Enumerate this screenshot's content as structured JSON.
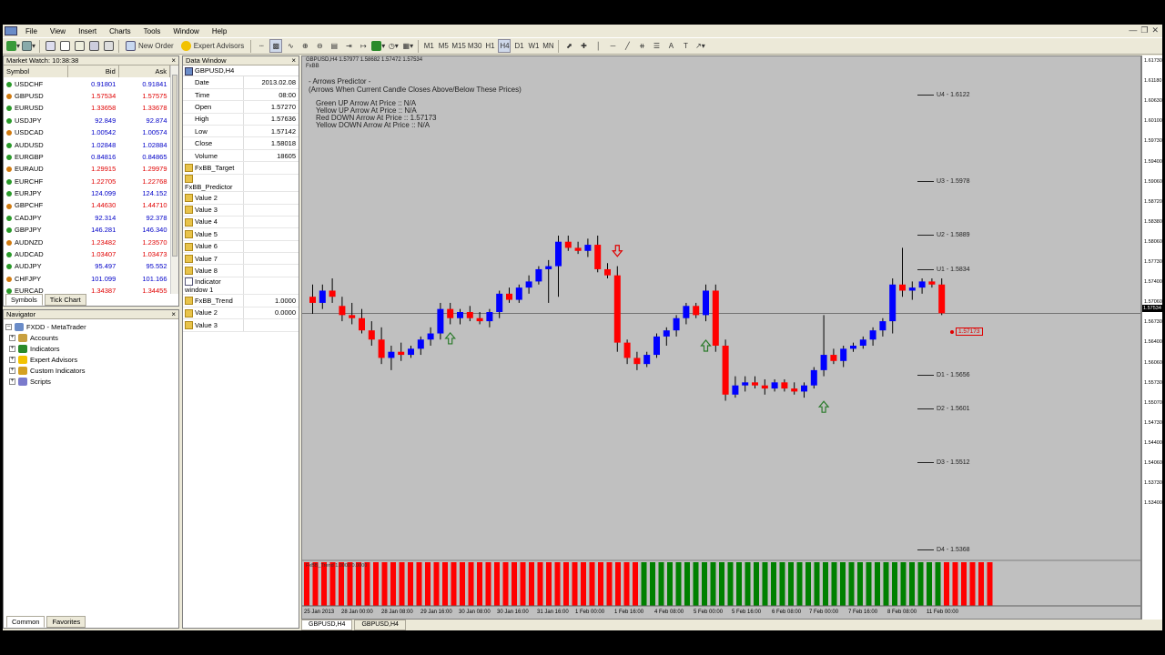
{
  "menu": [
    "File",
    "View",
    "Insert",
    "Charts",
    "Tools",
    "Window",
    "Help"
  ],
  "toolbar": {
    "new_order": "New Order",
    "expert_advisors": "Expert Advisors",
    "timeframes": [
      "M1",
      "M5",
      "M15",
      "M30",
      "H1",
      "H4",
      "D1",
      "W1",
      "MN"
    ]
  },
  "market_watch": {
    "title": "Market Watch: 10:38:38",
    "headers": {
      "symbol": "Symbol",
      "bid": "Bid",
      "ask": "Ask"
    },
    "rows": [
      {
        "symbol": "USDCHF",
        "bid": "0.91801",
        "ask": "0.91841",
        "dir": "up"
      },
      {
        "symbol": "GBPUSD",
        "bid": "1.57534",
        "ask": "1.57575",
        "dir": "dn"
      },
      {
        "symbol": "EURUSD",
        "bid": "1.33658",
        "ask": "1.33678",
        "dir": "dn"
      },
      {
        "symbol": "USDJPY",
        "bid": "92.849",
        "ask": "92.874",
        "dir": "up"
      },
      {
        "symbol": "USDCAD",
        "bid": "1.00542",
        "ask": "1.00574",
        "dir": "up"
      },
      {
        "symbol": "AUDUSD",
        "bid": "1.02848",
        "ask": "1.02884",
        "dir": "up"
      },
      {
        "symbol": "EURGBP",
        "bid": "0.84816",
        "ask": "0.84865",
        "dir": "up"
      },
      {
        "symbol": "EURAUD",
        "bid": "1.29915",
        "ask": "1.29979",
        "dir": "dn"
      },
      {
        "symbol": "EURCHF",
        "bid": "1.22705",
        "ask": "1.22768",
        "dir": "dn"
      },
      {
        "symbol": "EURJPY",
        "bid": "124.099",
        "ask": "124.152",
        "dir": "up"
      },
      {
        "symbol": "GBPCHF",
        "bid": "1.44630",
        "ask": "1.44710",
        "dir": "dn"
      },
      {
        "symbol": "CADJPY",
        "bid": "92.314",
        "ask": "92.378",
        "dir": "up"
      },
      {
        "symbol": "GBPJPY",
        "bid": "146.281",
        "ask": "146.340",
        "dir": "up"
      },
      {
        "symbol": "AUDNZD",
        "bid": "1.23482",
        "ask": "1.23570",
        "dir": "dn"
      },
      {
        "symbol": "AUDCAD",
        "bid": "1.03407",
        "ask": "1.03473",
        "dir": "dn"
      },
      {
        "symbol": "AUDJPY",
        "bid": "95.497",
        "ask": "95.552",
        "dir": "up"
      },
      {
        "symbol": "CHFJPY",
        "bid": "101.099",
        "ask": "101.166",
        "dir": "up"
      },
      {
        "symbol": "EURCAD",
        "bid": "1.34387",
        "ask": "1.34455",
        "dir": "dn"
      }
    ],
    "tabs": [
      "Symbols",
      "Tick Chart"
    ]
  },
  "data_window": {
    "title": "Data Window",
    "symbol": "GBPUSD,H4",
    "fields": [
      {
        "k": "Date",
        "v": "2013.02.08"
      },
      {
        "k": "Time",
        "v": "08:00"
      },
      {
        "k": "Open",
        "v": "1.57270"
      },
      {
        "k": "High",
        "v": "1.57636"
      },
      {
        "k": "Low",
        "v": "1.57142"
      },
      {
        "k": "Close",
        "v": "1.58018"
      },
      {
        "k": "Volume",
        "v": "18605"
      }
    ],
    "indicators": [
      {
        "k": "FxBB_Target",
        "v": "",
        "head": true
      },
      {
        "k": "FxBB_Predictor",
        "v": "",
        "head": true
      },
      {
        "k": "Value 2",
        "v": ""
      },
      {
        "k": "Value 3",
        "v": ""
      },
      {
        "k": "Value 4",
        "v": ""
      },
      {
        "k": "Value 5",
        "v": ""
      },
      {
        "k": "Value 6",
        "v": ""
      },
      {
        "k": "Value 7",
        "v": ""
      },
      {
        "k": "Value 8",
        "v": ""
      },
      {
        "k": "Indicator window 1",
        "v": "",
        "win": true
      },
      {
        "k": "FxBB_Trend",
        "v": "1.0000"
      },
      {
        "k": "Value 2",
        "v": "0.0000"
      },
      {
        "k": "Value 3",
        "v": ""
      }
    ]
  },
  "navigator": {
    "title": "Navigator",
    "root": "FXDD - MetaTrader",
    "items": [
      "Accounts",
      "Indicators",
      "Expert Advisors",
      "Custom Indicators",
      "Scripts"
    ],
    "tabs": [
      "Common",
      "Favorites"
    ]
  },
  "chart": {
    "header": "GBPUSD,H4  1.57977 1.58682 1.57472 1.57534",
    "sub": "FxBB",
    "predictor_title": "- Arrows Predictor -",
    "predictor_sub": "(Arrows When Current Candle Closes Above/Below These Prices)",
    "lines": [
      "Green UP Arrow At Price ::  N/A",
      "Yellow UP Arrow At Price ::  N/A",
      "Red DOWN Arrow At Price ::  1.57173",
      "Yellow DOWN Arrow At Price ::  N/A"
    ],
    "pivots": [
      {
        "label": "U4 - 1.6122"
      },
      {
        "label": "U3 - 1.5978"
      },
      {
        "label": "U2 - 1.5889"
      },
      {
        "label": "U1 - 1.5834"
      },
      {
        "label": "D1 - 1.5656"
      },
      {
        "label": "D2 - 1.5601"
      },
      {
        "label": "D3 - 1.5512"
      },
      {
        "label": "D4 - 1.5368"
      }
    ],
    "target_label": "1.57173",
    "subwindow_label": "FxBB_Trend 1.0000 0.0000",
    "price_axis": [
      "1.61730",
      "1.61180",
      "1.60630",
      "1.60100",
      "1.59730",
      "1.59400",
      "1.59060",
      "1.58720",
      "1.58380",
      "1.58060",
      "1.57730",
      "1.57400",
      "1.57060",
      "1.56730",
      "1.56400",
      "1.56060",
      "1.55730",
      "1.55070",
      "1.54730",
      "1.54400",
      "1.54060",
      "1.53730",
      "1.53400"
    ],
    "current_price": "1.57534",
    "x_labels": [
      "25 Jan 2013",
      "28 Jan 00:00",
      "28 Jan 08:00",
      "29 Jan 16:00",
      "30 Jan 08:00",
      "30 Jan 16:00",
      "31 Jan 16:00",
      "1 Feb 00:00",
      "1 Feb 16:00",
      "4 Feb 08:00",
      "5 Feb 00:00",
      "5 Feb 16:00",
      "6 Feb 08:00",
      "7 Feb 00:00",
      "7 Feb 16:00",
      "8 Feb 08:00",
      "11 Feb 00:00"
    ],
    "tabs": [
      "GBPUSD,H4",
      "GBPUSD,H4"
    ]
  },
  "chart_data": {
    "type": "candlestick",
    "symbol": "GBPUSD",
    "timeframe": "H4",
    "ylim": [
      1.534,
      1.6173
    ],
    "x": [
      "25 Jan 2013",
      "28 Jan 00:00",
      "28 Jan 08:00",
      "29 Jan 16:00",
      "30 Jan 08:00",
      "30 Jan 16:00",
      "31 Jan 16:00",
      "1 Feb 00:00",
      "1 Feb 16:00",
      "4 Feb 08:00",
      "5 Feb 00:00",
      "5 Feb 16:00",
      "6 Feb 08:00",
      "7 Feb 00:00",
      "7 Feb 16:00",
      "8 Feb 08:00",
      "11 Feb 00:00"
    ],
    "candles": [
      [
        1.578,
        1.58,
        1.5752,
        1.577
      ],
      [
        1.577,
        1.58,
        1.576,
        1.579
      ],
      [
        1.579,
        1.581,
        1.577,
        1.578
      ],
      [
        1.5765,
        1.578,
        1.574,
        1.575
      ],
      [
        1.575,
        1.577,
        1.5735,
        1.5745
      ],
      [
        1.5745,
        1.576,
        1.572,
        1.5725
      ],
      [
        1.5725,
        1.574,
        1.57,
        1.571
      ],
      [
        1.571,
        1.573,
        1.567,
        1.568
      ],
      [
        1.568,
        1.57,
        1.566,
        1.569
      ],
      [
        1.569,
        1.5705,
        1.5675,
        1.5685
      ],
      [
        1.5685,
        1.57,
        1.568,
        1.5695
      ],
      [
        1.5695,
        1.5715,
        1.5685,
        1.571
      ],
      [
        1.571,
        1.573,
        1.57,
        1.572
      ],
      [
        1.572,
        1.577,
        1.571,
        1.576
      ],
      [
        1.576,
        1.577,
        1.5735,
        1.5745
      ],
      [
        1.5745,
        1.576,
        1.5735,
        1.5755
      ],
      [
        1.5755,
        1.5765,
        1.574,
        1.5745
      ],
      [
        1.5745,
        1.5755,
        1.5735,
        1.574
      ],
      [
        1.574,
        1.576,
        1.573,
        1.5755
      ],
      [
        1.5755,
        1.579,
        1.5745,
        1.5785
      ],
      [
        1.5785,
        1.5795,
        1.577,
        1.5775
      ],
      [
        1.5775,
        1.58,
        1.577,
        1.5795
      ],
      [
        1.5795,
        1.5815,
        1.5785,
        1.5805
      ],
      [
        1.5805,
        1.583,
        1.58,
        1.5825
      ],
      [
        1.5825,
        1.584,
        1.577,
        1.583
      ],
      [
        1.583,
        1.588,
        1.578,
        1.587
      ],
      [
        1.587,
        1.588,
        1.5855,
        1.586
      ],
      [
        1.586,
        1.587,
        1.585,
        1.5855
      ],
      [
        1.5855,
        1.5875,
        1.5845,
        1.5865
      ],
      [
        1.5865,
        1.588,
        1.582,
        1.5825
      ],
      [
        1.5825,
        1.5835,
        1.581,
        1.5815
      ],
      [
        1.5815,
        1.583,
        1.569,
        1.5705
      ],
      [
        1.5705,
        1.571,
        1.567,
        1.568
      ],
      [
        1.568,
        1.569,
        1.566,
        1.567
      ],
      [
        1.567,
        1.569,
        1.5665,
        1.5685
      ],
      [
        1.5685,
        1.572,
        1.568,
        1.5715
      ],
      [
        1.5715,
        1.573,
        1.57,
        1.5725
      ],
      [
        1.5725,
        1.575,
        1.5715,
        1.5745
      ],
      [
        1.5745,
        1.577,
        1.5735,
        1.5765
      ],
      [
        1.5765,
        1.577,
        1.5745,
        1.575
      ],
      [
        1.575,
        1.58,
        1.574,
        1.579
      ],
      [
        1.579,
        1.58,
        1.569,
        1.57
      ],
      [
        1.57,
        1.571,
        1.561,
        1.562
      ],
      [
        1.562,
        1.565,
        1.5615,
        1.5635
      ],
      [
        1.5635,
        1.565,
        1.5625,
        1.564
      ],
      [
        1.564,
        1.565,
        1.563,
        1.5635
      ],
      [
        1.5635,
        1.5645,
        1.562,
        1.563
      ],
      [
        1.563,
        1.5645,
        1.5625,
        1.564
      ],
      [
        1.564,
        1.5645,
        1.5625,
        1.563
      ],
      [
        1.563,
        1.564,
        1.562,
        1.5625
      ],
      [
        1.5625,
        1.564,
        1.5615,
        1.5635
      ],
      [
        1.5635,
        1.5665,
        1.563,
        1.566
      ],
      [
        1.566,
        1.575,
        1.565,
        1.5685
      ],
      [
        1.5685,
        1.5695,
        1.567,
        1.5675
      ],
      [
        1.5675,
        1.57,
        1.5665,
        1.5695
      ],
      [
        1.5695,
        1.5705,
        1.569,
        1.57
      ],
      [
        1.57,
        1.5715,
        1.5695,
        1.571
      ],
      [
        1.571,
        1.573,
        1.57,
        1.5725
      ],
      [
        1.5725,
        1.5745,
        1.5715,
        1.574
      ],
      [
        1.574,
        1.581,
        1.572,
        1.58
      ],
      [
        1.58,
        1.586,
        1.578,
        1.579
      ],
      [
        1.579,
        1.5805,
        1.5775,
        1.5795
      ],
      [
        1.5795,
        1.581,
        1.5785,
        1.5805
      ],
      [
        1.5805,
        1.581,
        1.5795,
        1.58
      ],
      [
        1.58,
        1.581,
        1.575,
        1.5753
      ]
    ],
    "trend_histogram": {
      "red_bars": 39,
      "green_bars": 35,
      "red_bars_end": 6
    }
  }
}
